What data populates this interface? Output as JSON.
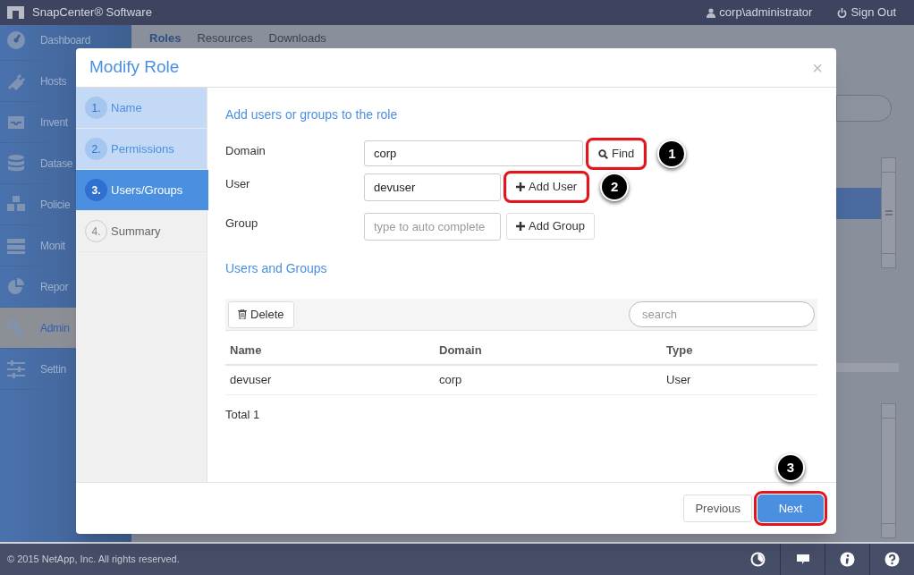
{
  "app": {
    "title": "SnapCenter® Software",
    "user": "corp\\administrator",
    "sign_out": "Sign Out"
  },
  "nav": [
    {
      "label": "Dashboard",
      "selected": false
    },
    {
      "label": "Hosts",
      "selected": false
    },
    {
      "label": "Invent",
      "selected": false
    },
    {
      "label": "Datase",
      "selected": false
    },
    {
      "label": "Policie",
      "selected": false
    },
    {
      "label": "Monit",
      "selected": false
    },
    {
      "label": "Repor",
      "selected": false
    },
    {
      "label": "Admin",
      "selected": true
    },
    {
      "label": "Settin",
      "selected": false
    }
  ],
  "page_tabs": [
    {
      "label": "Roles",
      "selected": true
    },
    {
      "label": "Resources",
      "selected": false
    },
    {
      "label": "Downloads",
      "selected": false
    }
  ],
  "dialog": {
    "title": "Modify Role",
    "close": "×",
    "steps": [
      {
        "number": "1.",
        "label": "Name",
        "selected": false,
        "completed": true
      },
      {
        "number": "2.",
        "label": "Permissions",
        "selected": false,
        "completed": true
      },
      {
        "number": "3.",
        "label": "Users/Groups",
        "selected": true,
        "completed": false
      },
      {
        "number": "4.",
        "label": "Summary",
        "selected": false,
        "completed": false
      }
    ],
    "heading": "Add users or groups to the role",
    "fields": [
      {
        "label": "Domain",
        "value": "corp",
        "kind": "wide",
        "button": {
          "label": "Find",
          "highlighted": true,
          "callout": "1"
        }
      },
      {
        "label": "User",
        "value": "devuser",
        "kind": "narrow",
        "button": {
          "label": "Add User",
          "highlighted": true,
          "callout": "2"
        }
      },
      {
        "label": "Group",
        "placeholder": "type to auto complete",
        "kind": "narrow",
        "button": {
          "label": "Add Group",
          "highlighted": false
        }
      }
    ],
    "section": "Users and Groups",
    "toolbar": {
      "delete": "Delete",
      "search_placeholder": "search"
    },
    "table": {
      "columns": [
        "Name",
        "Domain",
        "Type"
      ],
      "rows": [
        [
          "devuser",
          "corp",
          "User"
        ]
      ]
    },
    "total": "Total 1",
    "buttons": [
      {
        "label": "Previous",
        "kind": "secondary",
        "highlighted": false
      },
      {
        "label": "Next",
        "kind": "primary",
        "highlighted": true,
        "callout": "3"
      }
    ]
  },
  "footer": {
    "copyright": "© 2015 NetApp, Inc. All rights reserved."
  }
}
